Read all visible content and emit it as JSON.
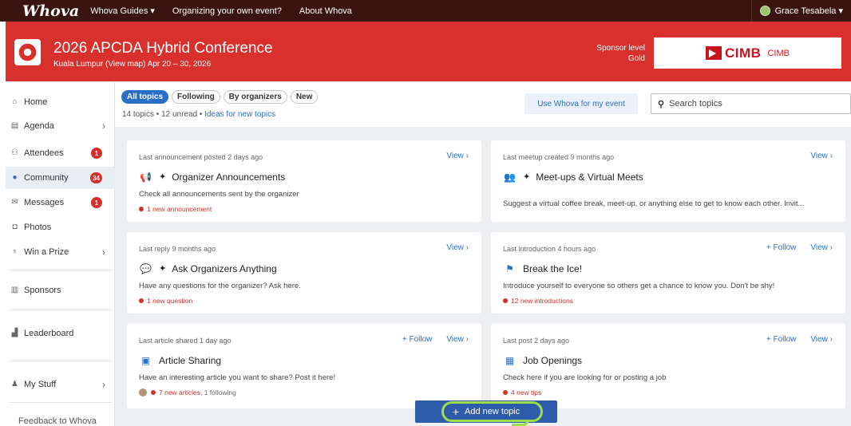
{
  "topbar": {
    "logo": "Whova",
    "nav": [
      "Whova Guides ▾",
      "Organizing your own event?",
      "About Whova"
    ],
    "user_name": "Grace Tesabela ▾"
  },
  "event": {
    "title": "2026 APCDA Hybrid Conference",
    "subtitle": "Kuala Lumpur (View map)  Apr 20 – 30, 2026",
    "sponsor_level_label": "Sponsor level",
    "sponsor_level": "Gold",
    "sponsor_brand": "CIMB",
    "sponsor_name": "CIMB"
  },
  "sidebar": {
    "items": [
      {
        "label": "Home",
        "icon": "home-icon"
      },
      {
        "label": "Agenda",
        "icon": "calendar-icon",
        "chevron": "›"
      },
      {
        "label": "Attendees",
        "icon": "people-icon",
        "badge": "1"
      },
      {
        "label": "Community",
        "icon": "chat-icon",
        "badge": "34"
      },
      {
        "label": "Messages",
        "icon": "envelope-icon",
        "badge": "1"
      },
      {
        "label": "Photos",
        "icon": "camera-icon"
      },
      {
        "label": "Win a Prize",
        "icon": "trophy-icon",
        "chevron": "›"
      },
      {
        "label": "Sponsors",
        "icon": "building-icon"
      },
      {
        "label": "Leaderboard",
        "icon": "leaderboard-icon"
      },
      {
        "label": "My Stuff",
        "icon": "person-icon",
        "chevron": "›"
      },
      {
        "label": "Feedback to Whova"
      }
    ]
  },
  "filters": {
    "tabs": [
      "All topics",
      "Following",
      "By organizers",
      "New"
    ],
    "active": "All topics",
    "stats_text": "14 topics • 12 unread • ",
    "ideas_link": "Ideas for new topics"
  },
  "use_whova_label": "Use Whova for my event",
  "search": {
    "placeholder": "Search topics"
  },
  "cards": [
    {
      "meta": "Last announcement posted 2 days ago",
      "view": "View ›",
      "title": "Organizer Announcements",
      "desc": "Check all announcements sent by the organizer",
      "news": "1 new announcement",
      "icon": "megaphone-icon"
    },
    {
      "meta": "Last meetup created 9 months ago",
      "view": "View ›",
      "title": "Meet-ups & Virtual Meets",
      "desc": "Suggest a virtual coffee break, meet-up, or anything else to get to know each other. Invit...",
      "icon": "group-icon"
    },
    {
      "meta": "Last reply 9 months ago",
      "view": "View ›",
      "title": "Ask Organizers Anything",
      "desc": "Have any questions for the organizer? Ask here.",
      "news": "1 new question",
      "icon": "speech-bubble-icon"
    },
    {
      "meta": "Last introduction 4 hours ago",
      "follow": "+ Follow",
      "view": "View ›",
      "title": "Break the Ice!",
      "desc": "Introduce yourself to everyone so others get a chance to know you. Don't be shy!",
      "news": "12 new introductions",
      "icon": "flag-icon"
    },
    {
      "meta": "Last article shared 1 day ago",
      "follow": "+ Follow",
      "view": "View ›",
      "title": "Article Sharing",
      "desc": "Have an interesting article you want to share? Post it here!",
      "news": "7 new articles",
      "news_extra": ", 1 following",
      "icon": "article-icon"
    },
    {
      "meta": "Last post 2 days ago",
      "follow": "+ Follow",
      "view": "View ›",
      "title": "Job Openings",
      "desc": "Check here if you are looking for or posting a job",
      "news": "4 new tips",
      "icon": "briefcase-icon"
    }
  ],
  "add_topic_label": "Add new topic",
  "colors": {
    "topbar": "#3a1410",
    "banner": "#d8302c",
    "accent": "#2a6fc7",
    "badge": "#d4302c",
    "highlight": "#9be04a"
  }
}
